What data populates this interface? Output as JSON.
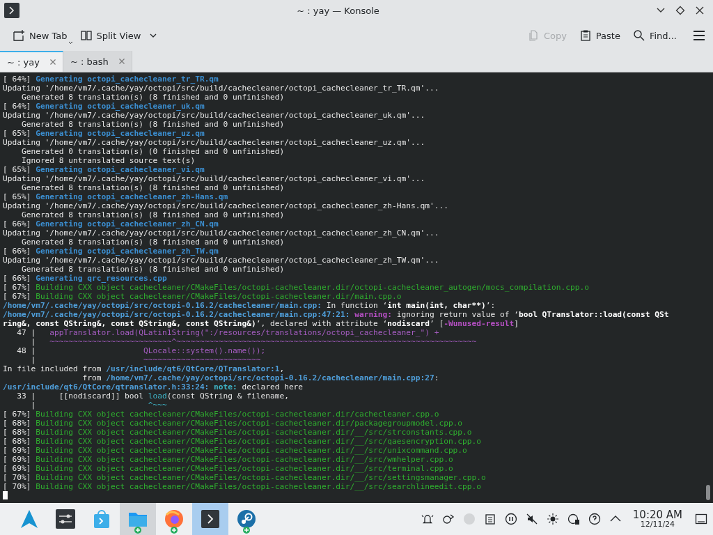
{
  "window": {
    "title": "~ : yay — Konsole"
  },
  "toolbar": {
    "left_buttons": [
      {
        "kind": "new-tab",
        "label": "New Tab",
        "disabled": false
      },
      {
        "kind": "split-view",
        "label": "Split View",
        "disabled": false
      }
    ],
    "right_buttons": [
      {
        "kind": "copy",
        "label": "Copy",
        "disabled": true
      },
      {
        "kind": "paste",
        "label": "Paste",
        "disabled": false
      },
      {
        "kind": "find",
        "label": "Find...",
        "disabled": false
      }
    ]
  },
  "tabs": [
    {
      "label": "~ : yay",
      "selected": true
    },
    {
      "label": "~ : bash",
      "selected": false
    }
  ],
  "terminal": {
    "lines": [
      {
        "segments": [
          {
            "kind": "plain",
            "text": "[ 64%] "
          },
          {
            "kind": "info",
            "text": "Generating octopi_cachecleaner_tr_TR.qm"
          }
        ]
      },
      {
        "segments": [
          {
            "kind": "plain",
            "text": "Updating '/home/vm7/.cache/yay/octopi/src/build/cachecleaner/octopi_cachecleaner_tr_TR.qm'..."
          }
        ]
      },
      {
        "segments": [
          {
            "kind": "plain",
            "text": "    Generated 8 translation(s) (8 finished and 0 unfinished)"
          }
        ]
      },
      {
        "segments": [
          {
            "kind": "plain",
            "text": "[ 64%] "
          },
          {
            "kind": "info",
            "text": "Generating octopi_cachecleaner_uk.qm"
          }
        ]
      },
      {
        "segments": [
          {
            "kind": "plain",
            "text": "Updating '/home/vm7/.cache/yay/octopi/src/build/cachecleaner/octopi_cachecleaner_uk.qm'..."
          }
        ]
      },
      {
        "segments": [
          {
            "kind": "plain",
            "text": "    Generated 8 translation(s) (8 finished and 0 unfinished)"
          }
        ]
      },
      {
        "segments": [
          {
            "kind": "plain",
            "text": "[ 65%] "
          },
          {
            "kind": "info",
            "text": "Generating octopi_cachecleaner_uz.qm"
          }
        ]
      },
      {
        "segments": [
          {
            "kind": "plain",
            "text": "Updating '/home/vm7/.cache/yay/octopi/src/build/cachecleaner/octopi_cachecleaner_uz.qm'..."
          }
        ]
      },
      {
        "segments": [
          {
            "kind": "plain",
            "text": "    Generated 0 translation(s) (0 finished and 0 unfinished)"
          }
        ]
      },
      {
        "segments": [
          {
            "kind": "plain",
            "text": "    Ignored 8 untranslated source text(s)"
          }
        ]
      },
      {
        "segments": [
          {
            "kind": "plain",
            "text": "[ 65%] "
          },
          {
            "kind": "info",
            "text": "Generating octopi_cachecleaner_vi.qm"
          }
        ]
      },
      {
        "segments": [
          {
            "kind": "plain",
            "text": "Updating '/home/vm7/.cache/yay/octopi/src/build/cachecleaner/octopi_cachecleaner_vi.qm'..."
          }
        ]
      },
      {
        "segments": [
          {
            "kind": "plain",
            "text": "    Generated 8 translation(s) (8 finished and 0 unfinished)"
          }
        ]
      },
      {
        "segments": [
          {
            "kind": "plain",
            "text": "[ 65%] "
          },
          {
            "kind": "info",
            "text": "Generating octopi_cachecleaner_zh-Hans.qm"
          }
        ]
      },
      {
        "segments": [
          {
            "kind": "plain",
            "text": "Updating '/home/vm7/.cache/yay/octopi/src/build/cachecleaner/octopi_cachecleaner_zh-Hans.qm'..."
          }
        ]
      },
      {
        "segments": [
          {
            "kind": "plain",
            "text": "    Generated 8 translation(s) (8 finished and 0 unfinished)"
          }
        ]
      },
      {
        "segments": [
          {
            "kind": "plain",
            "text": "[ 66%] "
          },
          {
            "kind": "info",
            "text": "Generating octopi_cachecleaner_zh_CN.qm"
          }
        ]
      },
      {
        "segments": [
          {
            "kind": "plain",
            "text": "Updating '/home/vm7/.cache/yay/octopi/src/build/cachecleaner/octopi_cachecleaner_zh_CN.qm'..."
          }
        ]
      },
      {
        "segments": [
          {
            "kind": "plain",
            "text": "    Generated 8 translation(s) (8 finished and 0 unfinished)"
          }
        ]
      },
      {
        "segments": [
          {
            "kind": "plain",
            "text": "[ 66%] "
          },
          {
            "kind": "info",
            "text": "Generating octopi_cachecleaner_zh_TW.qm"
          }
        ]
      },
      {
        "segments": [
          {
            "kind": "plain",
            "text": "Updating '/home/vm7/.cache/yay/octopi/src/build/cachecleaner/octopi_cachecleaner_zh_TW.qm'..."
          }
        ]
      },
      {
        "segments": [
          {
            "kind": "plain",
            "text": "    Generated 8 translation(s) (8 finished and 0 unfinished)"
          }
        ]
      },
      {
        "segments": [
          {
            "kind": "plain",
            "text": "[ 66%] "
          },
          {
            "kind": "info",
            "text": "Generating qrc_resources.cpp"
          }
        ]
      },
      {
        "segments": [
          {
            "kind": "plain",
            "text": "[ 67%] "
          },
          {
            "kind": "build",
            "text": "Building CXX object cachecleaner/CMakeFiles/octopi-cachecleaner.dir/octopi-cachecleaner_autogen/mocs_compilation.cpp.o"
          }
        ]
      },
      {
        "segments": [
          {
            "kind": "plain",
            "text": "[ 67%] "
          },
          {
            "kind": "build",
            "text": "Building CXX object cachecleaner/CMakeFiles/octopi-cachecleaner.dir/main.cpp.o"
          }
        ]
      },
      {
        "segments": [
          {
            "kind": "path",
            "text": "/home/vm7/.cache/yay/octopi/src/octopi-0.16.2/cachecleaner/main.cpp:"
          },
          {
            "kind": "plain",
            "text": " In function ‘"
          },
          {
            "kind": "bold",
            "text": "int main(int, char**)"
          },
          {
            "kind": "plain",
            "text": "’:"
          }
        ]
      },
      {
        "segments": [
          {
            "kind": "path",
            "text": "/home/vm7/.cache/yay/octopi/src/octopi-0.16.2/cachecleaner/main.cpp:47:21:"
          },
          {
            "kind": "warning",
            "text": " warning:"
          },
          {
            "kind": "plain",
            "text": " ignoring return value of ‘"
          },
          {
            "kind": "bold",
            "text": "bool QTranslator::load(const QSt"
          }
        ]
      },
      {
        "segments": [
          {
            "kind": "bold",
            "text": "ring&, const QString&, const QString&, const QString&)"
          },
          {
            "kind": "plain",
            "text": "’, declared with attribute ‘"
          },
          {
            "kind": "bold",
            "text": "nodiscard"
          },
          {
            "kind": "plain",
            "text": "’ ["
          },
          {
            "kind": "warning",
            "text": "-Wunused-result"
          },
          {
            "kind": "plain",
            "text": "]"
          }
        ]
      },
      {
        "segments": [
          {
            "kind": "plain",
            "text": "   47 |   "
          },
          {
            "kind": "code",
            "text": "appTranslator.load(QLatin1String(\":/resources/translations/octopi_cachecleaner_\") +"
          }
        ]
      },
      {
        "segments": [
          {
            "kind": "plain",
            "text": "      |   "
          },
          {
            "kind": "code",
            "text": "~~~~~~~~~~~~~~~~~~~~~~~~~~^~~~~~~~~~~~~~~~~~~~~~~~~~~~~~~~~~~~~~~~~~~~~~~~~~~~~~~~~~~~~~~~~"
          }
        ]
      },
      {
        "segments": [
          {
            "kind": "plain",
            "text": "   48 |                       "
          },
          {
            "kind": "code",
            "text": "QLocale::system().name());"
          }
        ]
      },
      {
        "segments": [
          {
            "kind": "plain",
            "text": "      |                       "
          },
          {
            "kind": "code",
            "text": "~~~~~~~~~~~~~~~~~~~~~~~~~"
          }
        ]
      },
      {
        "segments": [
          {
            "kind": "plain",
            "text": "In file included from "
          },
          {
            "kind": "path",
            "text": "/usr/include/qt6/QtCore/QTranslator:1"
          },
          {
            "kind": "plain",
            "text": ","
          }
        ]
      },
      {
        "segments": [
          {
            "kind": "plain",
            "text": "                 from "
          },
          {
            "kind": "path",
            "text": "/home/vm7/.cache/yay/octopi/src/octopi-0.16.2/cachecleaner/main.cpp:27"
          },
          {
            "kind": "plain",
            "text": ":"
          }
        ]
      },
      {
        "segments": [
          {
            "kind": "path",
            "text": "/usr/include/qt6/QtCore/qtranslator.h:33:24:"
          },
          {
            "kind": "note",
            "text": " note:"
          },
          {
            "kind": "plain",
            "text": " declared here"
          }
        ]
      },
      {
        "segments": [
          {
            "kind": "plain",
            "text": "   33 |     [[nodiscard]] bool "
          },
          {
            "kind": "hint",
            "text": "load"
          },
          {
            "kind": "plain",
            "text": "(const QString & filename,"
          }
        ]
      },
      {
        "segments": [
          {
            "kind": "plain",
            "text": "      |                        "
          },
          {
            "kind": "hint",
            "text": "^~~~"
          }
        ]
      },
      {
        "segments": [
          {
            "kind": "plain",
            "text": "[ 67%] "
          },
          {
            "kind": "build",
            "text": "Building CXX object cachecleaner/CMakeFiles/octopi-cachecleaner.dir/cachecleaner.cpp.o"
          }
        ]
      },
      {
        "segments": [
          {
            "kind": "plain",
            "text": "[ 68%] "
          },
          {
            "kind": "build",
            "text": "Building CXX object cachecleaner/CMakeFiles/octopi-cachecleaner.dir/packagegroupmodel.cpp.o"
          }
        ]
      },
      {
        "segments": [
          {
            "kind": "plain",
            "text": "[ 68%] "
          },
          {
            "kind": "build",
            "text": "Building CXX object cachecleaner/CMakeFiles/octopi-cachecleaner.dir/__/src/strconstants.cpp.o"
          }
        ]
      },
      {
        "segments": [
          {
            "kind": "plain",
            "text": "[ 68%] "
          },
          {
            "kind": "build",
            "text": "Building CXX object cachecleaner/CMakeFiles/octopi-cachecleaner.dir/__/src/qaesencryption.cpp.o"
          }
        ]
      },
      {
        "segments": [
          {
            "kind": "plain",
            "text": "[ 69%] "
          },
          {
            "kind": "build",
            "text": "Building CXX object cachecleaner/CMakeFiles/octopi-cachecleaner.dir/__/src/unixcommand.cpp.o"
          }
        ]
      },
      {
        "segments": [
          {
            "kind": "plain",
            "text": "[ 69%] "
          },
          {
            "kind": "build",
            "text": "Building CXX object cachecleaner/CMakeFiles/octopi-cachecleaner.dir/__/src/wmhelper.cpp.o"
          }
        ]
      },
      {
        "segments": [
          {
            "kind": "plain",
            "text": "[ 69%] "
          },
          {
            "kind": "build",
            "text": "Building CXX object cachecleaner/CMakeFiles/octopi-cachecleaner.dir/__/src/terminal.cpp.o"
          }
        ]
      },
      {
        "segments": [
          {
            "kind": "plain",
            "text": "[ 70%] "
          },
          {
            "kind": "build",
            "text": "Building CXX object cachecleaner/CMakeFiles/octopi-cachecleaner.dir/__/src/settingsmanager.cpp.o"
          }
        ]
      },
      {
        "segments": [
          {
            "kind": "plain",
            "text": "[ 70%] "
          },
          {
            "kind": "build",
            "text": "Building CXX object cachecleaner/CMakeFiles/octopi-cachecleaner.dir/__/src/searchlineedit.cpp.o"
          }
        ]
      }
    ]
  },
  "taskbar": {
    "apps": [
      {
        "kind": "launcher",
        "open": false,
        "selected": false,
        "badge": false
      },
      {
        "kind": "settings",
        "open": false,
        "selected": false,
        "badge": false
      },
      {
        "kind": "store",
        "open": false,
        "selected": false,
        "badge": false
      },
      {
        "kind": "files",
        "open": true,
        "selected": false,
        "badge": true
      },
      {
        "kind": "browser",
        "open": false,
        "selected": false,
        "badge": true
      },
      {
        "kind": "terminal",
        "open": false,
        "selected": true,
        "badge": false
      },
      {
        "kind": "steam",
        "open": false,
        "selected": false,
        "badge": true
      }
    ],
    "clock": {
      "time": "10:20 AM",
      "date": "12/11/24"
    }
  }
}
